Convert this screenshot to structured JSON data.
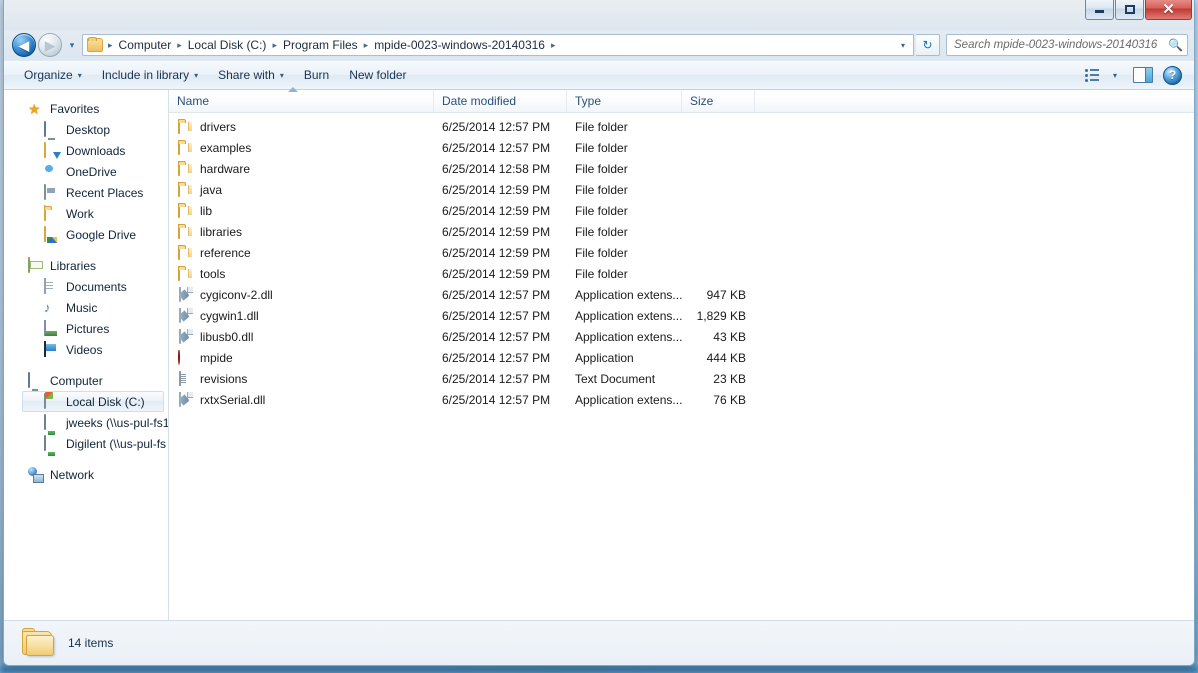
{
  "window": {
    "controls": {
      "minimize": "Minimize",
      "maximize": "Maximize",
      "close": "✕"
    }
  },
  "address": {
    "back_label": "◀",
    "forward_label": "▶",
    "recent_pages_label": "▾",
    "breadcrumb": [
      "Computer",
      "Local Disk (C:)",
      "Program Files",
      "mpide-0023-windows-20140316"
    ],
    "separator": "▸",
    "dropdown_label": "▾",
    "refresh_label": "↻",
    "search_placeholder": "Search mpide-0023-windows-20140316",
    "search_value": ""
  },
  "commandbar": {
    "items": [
      {
        "label": "Organize",
        "caret": "▾"
      },
      {
        "label": "Include in library",
        "caret": "▾"
      },
      {
        "label": "Share with",
        "caret": "▾"
      },
      {
        "label": "Burn",
        "caret": ""
      },
      {
        "label": "New folder",
        "caret": ""
      }
    ],
    "view_caret": "▾",
    "help_label": "?"
  },
  "navpane": {
    "groups": [
      {
        "root": {
          "label": "Favorites",
          "icon": "star-icon"
        },
        "items": [
          {
            "label": "Desktop",
            "icon": "desktop-icon"
          },
          {
            "label": "Downloads",
            "icon": "downloads-icon"
          },
          {
            "label": "OneDrive",
            "icon": "onedrive-icon"
          },
          {
            "label": "Recent Places",
            "icon": "recent-places-icon"
          },
          {
            "label": "Work",
            "icon": "folder-icon"
          },
          {
            "label": "Google Drive",
            "icon": "google-drive-icon"
          }
        ]
      },
      {
        "root": {
          "label": "Libraries",
          "icon": "libraries-icon"
        },
        "items": [
          {
            "label": "Documents",
            "icon": "documents-icon"
          },
          {
            "label": "Music",
            "icon": "music-icon"
          },
          {
            "label": "Pictures",
            "icon": "pictures-icon"
          },
          {
            "label": "Videos",
            "icon": "videos-icon"
          }
        ]
      },
      {
        "root": {
          "label": "Computer",
          "icon": "computer-icon"
        },
        "items": [
          {
            "label": "Local Disk (C:)",
            "icon": "local-disk-icon",
            "selected": true
          },
          {
            "label": "jweeks (\\\\us-pul-fs1",
            "icon": "network-drive-icon"
          },
          {
            "label": "Digilent (\\\\us-pul-fs",
            "icon": "network-drive-icon"
          }
        ]
      },
      {
        "root": {
          "label": "Network",
          "icon": "network-icon"
        },
        "items": []
      }
    ]
  },
  "filelist": {
    "columns": [
      "Name",
      "Date modified",
      "Type",
      "Size"
    ],
    "sorted_by": "Name",
    "sort_direction": "ascending",
    "rows": [
      {
        "name": "drivers",
        "date": "6/25/2014 12:57 PM",
        "type": "File folder",
        "size": "",
        "icon": "folder-icon"
      },
      {
        "name": "examples",
        "date": "6/25/2014 12:57 PM",
        "type": "File folder",
        "size": "",
        "icon": "folder-icon"
      },
      {
        "name": "hardware",
        "date": "6/25/2014 12:58 PM",
        "type": "File folder",
        "size": "",
        "icon": "folder-icon"
      },
      {
        "name": "java",
        "date": "6/25/2014 12:59 PM",
        "type": "File folder",
        "size": "",
        "icon": "folder-icon"
      },
      {
        "name": "lib",
        "date": "6/25/2014 12:59 PM",
        "type": "File folder",
        "size": "",
        "icon": "folder-icon"
      },
      {
        "name": "libraries",
        "date": "6/25/2014 12:59 PM",
        "type": "File folder",
        "size": "",
        "icon": "folder-icon"
      },
      {
        "name": "reference",
        "date": "6/25/2014 12:59 PM",
        "type": "File folder",
        "size": "",
        "icon": "folder-icon"
      },
      {
        "name": "tools",
        "date": "6/25/2014 12:59 PM",
        "type": "File folder",
        "size": "",
        "icon": "folder-icon"
      },
      {
        "name": "cygiconv-2.dll",
        "date": "6/25/2014 12:57 PM",
        "type": "Application extens...",
        "size": "947 KB",
        "icon": "dll-icon"
      },
      {
        "name": "cygwin1.dll",
        "date": "6/25/2014 12:57 PM",
        "type": "Application extens...",
        "size": "1,829 KB",
        "icon": "dll-icon"
      },
      {
        "name": "libusb0.dll",
        "date": "6/25/2014 12:57 PM",
        "type": "Application extens...",
        "size": "43 KB",
        "icon": "dll-icon"
      },
      {
        "name": "mpide",
        "date": "6/25/2014 12:57 PM",
        "type": "Application",
        "size": "444 KB",
        "icon": "application-icon"
      },
      {
        "name": "revisions",
        "date": "6/25/2014 12:57 PM",
        "type": "Text Document",
        "size": "23 KB",
        "icon": "text-document-icon"
      },
      {
        "name": "rxtxSerial.dll",
        "date": "6/25/2014 12:57 PM",
        "type": "Application extens...",
        "size": "76 KB",
        "icon": "dll-icon"
      }
    ]
  },
  "statusbar": {
    "item_count": "14 items"
  },
  "colors": {
    "accent": "#2f6fa8",
    "folder": "#f4cf7d",
    "close_button": "#c03a34",
    "header_text": "#2a5078"
  }
}
